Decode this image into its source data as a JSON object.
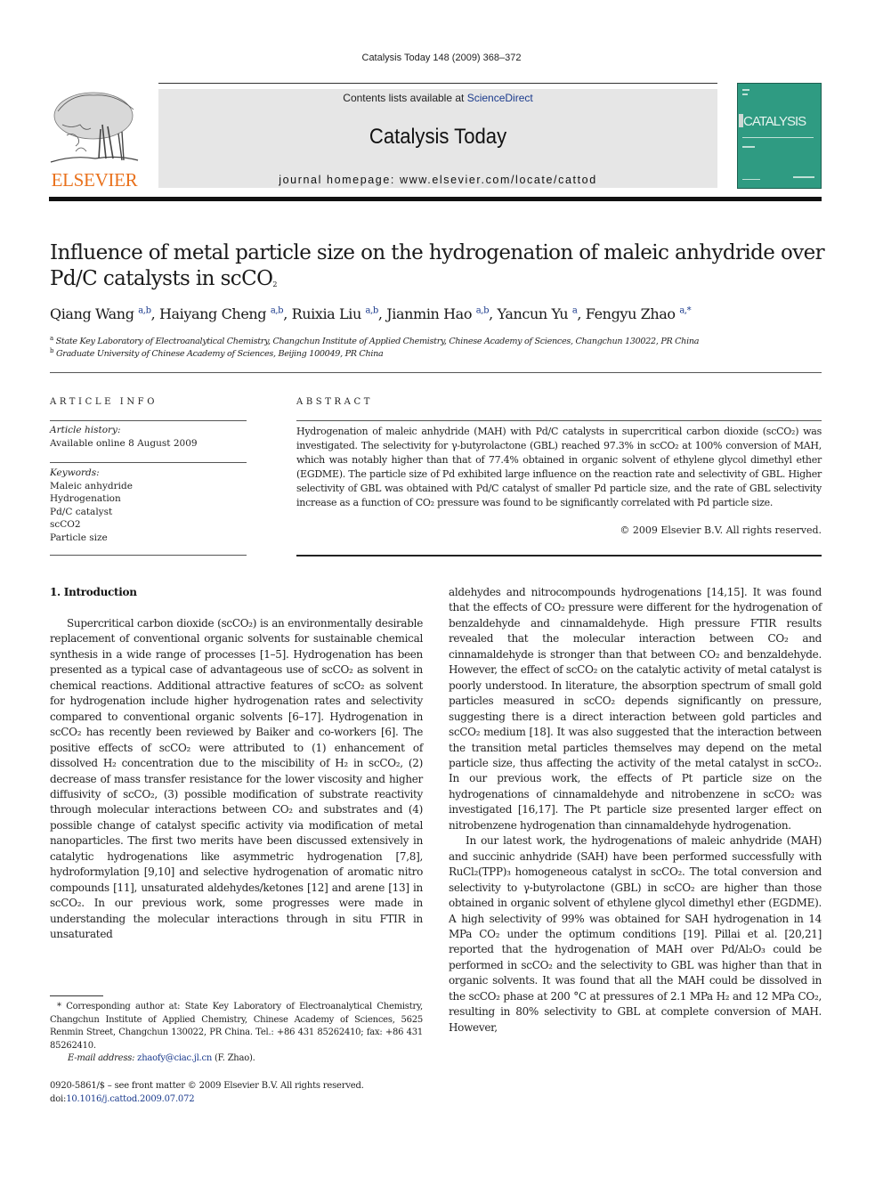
{
  "header": {
    "running_head": "Catalysis Today 148 (2009) 368–372",
    "publisher_logo": "ELSEVIER",
    "contents_prefix": "Contents lists available at ",
    "contents_link": "ScienceDirect",
    "journal_title": "Catalysis Today",
    "homepage": "journal homepage: www.elsevier.com/locate/cattod",
    "cover_title": "CATALYSIS",
    "brand_color": "#e9711c",
    "cover_color": "#2f9b82",
    "link_color": "#1a3a8c"
  },
  "article": {
    "title_line1": "Influence of metal particle size on the hydrogenation of maleic anhydride over",
    "title_line2_prefix": "Pd/C catalysts in scCO",
    "title_line2_sub": "2",
    "authors": [
      {
        "name": "Qiang Wang",
        "affil": "a,b"
      },
      {
        "name": "Haiyang Cheng",
        "affil": "a,b"
      },
      {
        "name": "Ruixia Liu",
        "affil": "a,b"
      },
      {
        "name": "Jianmin Hao",
        "affil": "a,b"
      },
      {
        "name": "Yancun Yu",
        "affil": "a"
      },
      {
        "name": "Fengyu Zhao",
        "affil": "a,*"
      }
    ],
    "affiliations": [
      {
        "mark": "a",
        "text": "State Key Laboratory of Electroanalytical Chemistry, Changchun Institute of Applied Chemistry, Chinese Academy of Sciences, Changchun 130022, PR China"
      },
      {
        "mark": "b",
        "text": "Graduate University of Chinese Academy of Sciences, Beijing 100049, PR China"
      }
    ]
  },
  "article_info": {
    "heading": "ARTICLE INFO",
    "history_label": "Article history:",
    "history_value": "Available online 8 August 2009",
    "keywords_label": "Keywords:",
    "keywords": [
      "Maleic anhydride",
      "Hydrogenation",
      "Pd/C catalyst",
      "scCO2",
      "Particle size"
    ]
  },
  "abstract": {
    "heading": "ABSTRACT",
    "text": "Hydrogenation of maleic anhydride (MAH) with Pd/C catalysts in supercritical carbon dioxide (scCO₂) was investigated. The selectivity for γ-butyrolactone (GBL) reached 97.3% in scCO₂ at 100% conversion of MAH, which was notably higher than that of 77.4% obtained in organic solvent of ethylene glycol dimethyl ether (EGDME). The particle size of Pd exhibited large influence on the reaction rate and selectivity of GBL. Higher selectivity of GBL was obtained with Pd/C catalyst of smaller Pd particle size, and the rate of GBL selectivity increase as a function of CO₂ pressure was found to be significantly correlated with Pd particle size.",
    "copyright": "© 2009 Elsevier B.V. All rights reserved."
  },
  "intro": {
    "heading": "1.  Introduction",
    "left_p1": "Supercritical carbon dioxide (scCO₂) is an environmentally desirable replacement of conventional organic solvents for sustainable chemical synthesis in a wide range of processes [1–5]. Hydrogenation has been presented as a typical case of advantageous use of scCO₂ as solvent in chemical reactions. Additional attractive features of scCO₂ as solvent for hydrogenation include higher hydrogenation rates and selectivity compared to conventional organic solvents [6–17]. Hydrogenation in scCO₂ has recently been reviewed by Baiker and co-workers [6]. The positive effects of scCO₂ were attributed to (1) enhancement of dissolved H₂ concentration due to the miscibility of H₂ in scCO₂, (2) decrease of mass transfer resistance for the lower viscosity and higher diffusivity of scCO₂, (3) possible modification of substrate reactivity through molecular interactions between CO₂ and substrates and (4) possible change of catalyst specific activity via modification of metal nanoparticles. The first two merits have been discussed extensively in catalytic hydrogenations like asymmetric hydrogenation [7,8], hydroformylation [9,10] and selective hydrogenation of aromatic nitro compounds [11], unsaturated aldehydes/ketones [12] and arene [13] in scCO₂. In our previous work, some progresses were made in understanding the molecular interactions through in situ FTIR in unsaturated",
    "right_p1": "aldehydes and nitrocompounds hydrogenations [14,15]. It was found that the effects of CO₂ pressure were different for the hydrogenation of benzaldehyde and cinnamaldehyde. High pressure FTIR results revealed that the molecular interaction between CO₂ and cinnamaldehyde is stronger than that between CO₂ and benzaldehyde. However, the effect of scCO₂ on the catalytic activity of metal catalyst is poorly understood. In literature, the absorption spectrum of small gold particles measured in scCO₂ depends significantly on pressure, suggesting there is a direct interaction between gold particles and scCO₂ medium [18]. It was also suggested that the interaction between the transition metal particles themselves may depend on the metal particle size, thus affecting the activity of the metal catalyst in scCO₂. In our previous work, the effects of Pt particle size on the hydrogenations of cinnamaldehyde and nitrobenzene in scCO₂ was investigated [16,17]. The Pt particle size presented larger effect on nitrobenzene hydrogenation than cinnamaldehyde hydrogenation.",
    "right_p2": "In our latest work, the hydrogenations of maleic anhydride (MAH) and succinic anhydride (SAH) have been performed successfully with RuCl₂(TPP)₃ homogeneous catalyst in scCO₂. The total conversion and selectivity to γ-butyrolactone (GBL) in scCO₂ are higher than those obtained in organic solvent of ethylene glycol dimethyl ether (EGDME). A high selectivity of 99% was obtained for SAH hydrogenation in 14 MPa CO₂ under the optimum conditions [19]. Pillai et al. [20,21] reported that the hydrogenation of MAH over Pd/Al₂O₃ could be performed in scCO₂ and the selectivity to GBL was higher than that in organic solvents. It was found that all the MAH could be dissolved in the scCO₂ phase at 200 °C at pressures of 2.1 MPa H₂ and 12 MPa CO₂, resulting in 80% selectivity to GBL at complete conversion of MAH. However,"
  },
  "footnote": {
    "corresponding": "* Corresponding author at: State Key Laboratory of Electroanalytical Chemistry, Changchun Institute of Applied Chemistry, Chinese Academy of Sciences, 5625 Renmin Street, Changchun 130022, PR China. Tel.: +86 431 85262410; fax: +86 431 85262410.",
    "email_label": "E-mail address:",
    "email": "zhaofy@ciac.jl.cn",
    "email_suffix": " (F. Zhao).",
    "issn_line": "0920-5861/$ – see front matter © 2009 Elsevier B.V. All rights reserved.",
    "doi_prefix": "doi:",
    "doi": "10.1016/j.cattod.2009.07.072"
  }
}
